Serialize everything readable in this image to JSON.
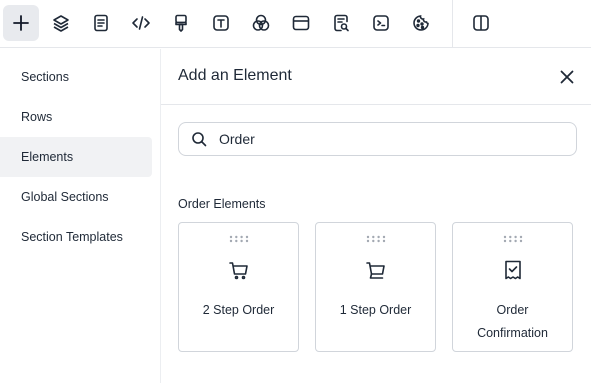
{
  "toolbar": {
    "buttons": [
      {
        "name": "add-icon"
      },
      {
        "name": "layers-icon"
      },
      {
        "name": "page-icon"
      },
      {
        "name": "code-icon"
      },
      {
        "name": "brush-icon"
      },
      {
        "name": "text-icon"
      },
      {
        "name": "colors-icon"
      },
      {
        "name": "browser-window-icon"
      },
      {
        "name": "document-search-icon"
      },
      {
        "name": "terminal-icon"
      },
      {
        "name": "cookie-icon"
      },
      {
        "name": "split-view-icon"
      }
    ]
  },
  "sidebar": {
    "items": [
      {
        "label": "Sections",
        "active": false
      },
      {
        "label": "Rows",
        "active": false
      },
      {
        "label": "Elements",
        "active": true
      },
      {
        "label": "Global Sections",
        "active": false
      },
      {
        "label": "Section Templates",
        "active": false
      }
    ]
  },
  "panel": {
    "title": "Add an Element",
    "search": {
      "value": "Order",
      "placeholder": ""
    },
    "section_label": "Order Elements",
    "cards": [
      {
        "label": "2 Step Order",
        "icon": "cart-icon"
      },
      {
        "label": "1 Step Order",
        "icon": "cart-icon"
      },
      {
        "label": "Order Confirmation",
        "icon": "receipt-check-icon"
      }
    ]
  },
  "colors": {
    "active_bg": "#e8eaee",
    "border": "#d1d5db",
    "text": "#1f2937"
  }
}
